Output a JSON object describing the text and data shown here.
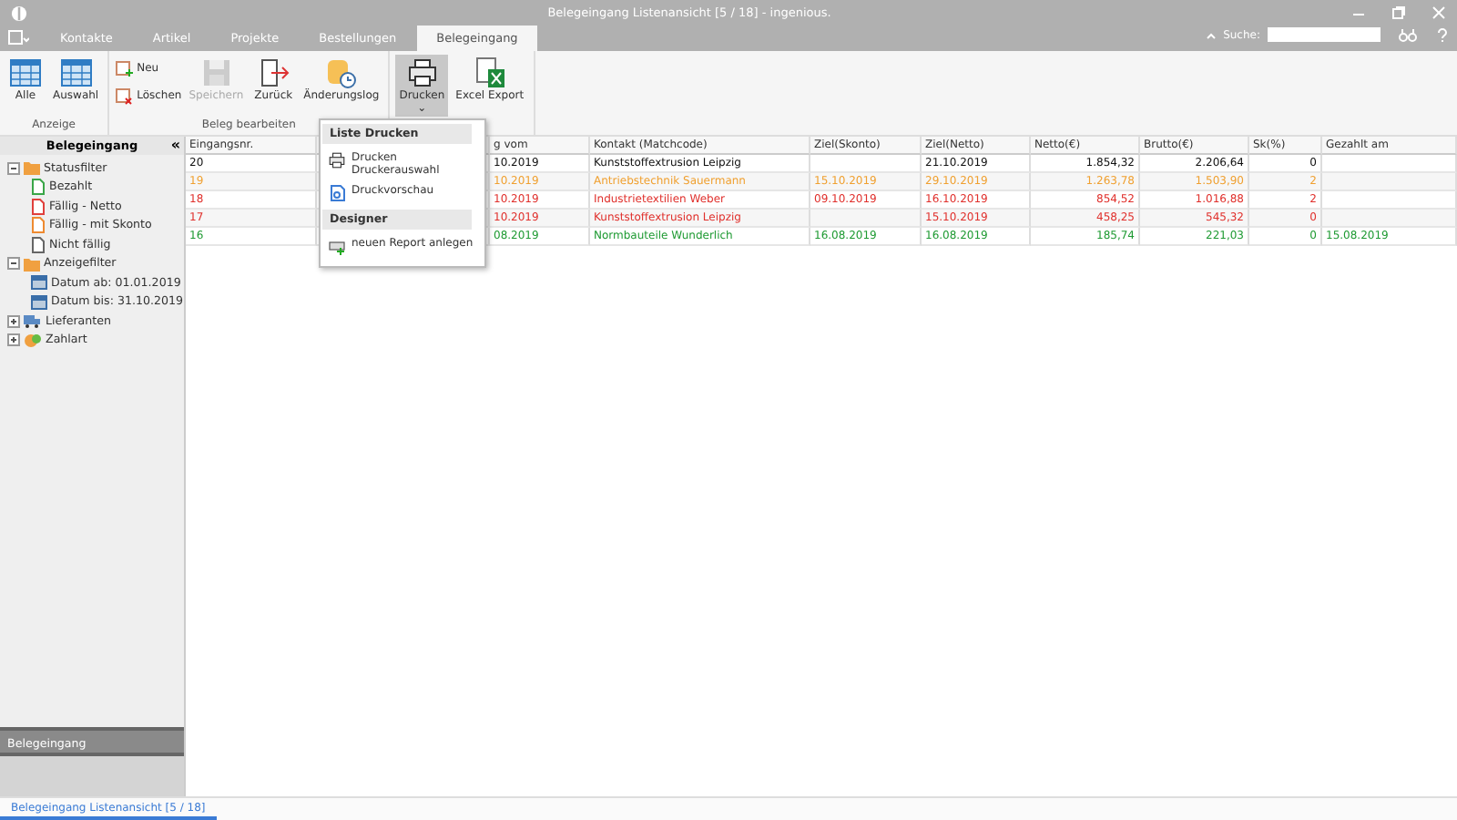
{
  "window": {
    "title": "Belegeingang Listenansicht [5 / 18] - ingenious."
  },
  "tabs": [
    {
      "label": "Kontakte",
      "selected": false
    },
    {
      "label": "Artikel",
      "selected": false
    },
    {
      "label": "Projekte",
      "selected": false
    },
    {
      "label": "Bestellungen",
      "selected": false
    },
    {
      "label": "Belegeingang",
      "selected": true
    }
  ],
  "search": {
    "label": "Suche:"
  },
  "ribbon": [
    {
      "title": "Anzeige",
      "buttons": [
        {
          "kind": "large",
          "label": "Alle",
          "disabled": false,
          "pressed": false
        },
        {
          "kind": "large",
          "label": "Auswahl",
          "disabled": false,
          "pressed": false
        }
      ]
    },
    {
      "title": "Beleg bearbeiten",
      "buttons": [
        {
          "kind": "small",
          "label": "Neu"
        },
        {
          "kind": "small",
          "label": "Löschen"
        },
        {
          "kind": "large",
          "label": "Speichern",
          "disabled": true,
          "pressed": false
        },
        {
          "kind": "large",
          "label": "Zurück",
          "disabled": false,
          "pressed": false
        },
        {
          "kind": "large",
          "label": "Änderungslog",
          "disabled": false,
          "pressed": false
        }
      ]
    },
    {
      "buttons": [
        {
          "kind": "large",
          "label": "Drucken",
          "disabled": false,
          "pressed": true,
          "caret": "⌄"
        },
        {
          "kind": "large",
          "label": "Excel Export",
          "disabled": false,
          "pressed": false
        }
      ]
    }
  ],
  "sidebar": {
    "title": "Belegeingang",
    "collapse": "«",
    "tree": [
      {
        "label": "Statusfilter",
        "expanded": true,
        "children": [
          {
            "kind": "status",
            "label": "Bezahlt",
            "color": "#3aa648"
          },
          {
            "kind": "status",
            "label": "Fällig - Netto",
            "color": "#e0403c"
          },
          {
            "kind": "status",
            "label": "Fällig - mit Skonto",
            "color": "#ee8a30"
          },
          {
            "kind": "status",
            "label": "Nicht fällig",
            "color": "#666666"
          }
        ]
      },
      {
        "label": "Anzeigefilter",
        "expanded": true,
        "children": [
          {
            "kind": "date",
            "label": "Datum ab: 01.01.2019"
          },
          {
            "kind": "date",
            "label": "Datum bis: 31.10.2019"
          }
        ]
      },
      {
        "label": "Lieferanten",
        "expanded": false
      },
      {
        "label": "Zahlart",
        "expanded": false
      }
    ],
    "bottom_panel": "Belegeingang"
  },
  "table": {
    "columns": [
      "Eingangsnr.",
      "",
      "g vom",
      "Kontakt (Matchcode)",
      "Ziel(Skonto)",
      "Ziel(Netto)",
      "Netto(€)",
      "Brutto(€)",
      "Sk(%)",
      "Gezahlt am"
    ],
    "rows": [
      {
        "color": "#111111",
        "cells": [
          "20",
          "",
          "10.2019",
          "Kunststoffextrusion Leipzig",
          "",
          "21.10.2019",
          "1.854,32",
          "2.206,64",
          "0",
          ""
        ]
      },
      {
        "color": "#f0a030",
        "cells": [
          "19",
          "",
          "10.2019",
          "Antriebstechnik Sauermann",
          "15.10.2019",
          "29.10.2019",
          "1.263,78",
          "1.503,90",
          "2",
          ""
        ]
      },
      {
        "color": "#e0302c",
        "cells": [
          "18",
          "",
          "10.2019",
          "Industrietextilien Weber",
          "09.10.2019",
          "16.10.2019",
          "854,52",
          "1.016,88",
          "2",
          ""
        ]
      },
      {
        "color": "#e0302c",
        "cells": [
          "17",
          "",
          "10.2019",
          "Kunststoffextrusion Leipzig",
          "",
          "15.10.2019",
          "458,25",
          "545,32",
          "0",
          ""
        ]
      },
      {
        "color": "#1e9a32",
        "cells": [
          "16",
          "",
          "08.2019",
          "Normbauteile Wunderlich",
          "16.08.2019",
          "16.08.2019",
          "185,74",
          "221,03",
          "0",
          "15.08.2019"
        ]
      }
    ]
  },
  "dropdown": {
    "sections": [
      {
        "title": "Liste Drucken",
        "items": [
          {
            "label": "Drucken",
            "sublabel": "Druckerauswahl"
          },
          {
            "label": "Druckvorschau"
          }
        ]
      },
      {
        "title": "Designer",
        "items": [
          {
            "label": "neuen Report anlegen"
          }
        ]
      }
    ]
  },
  "status_bar": {
    "tabs": [
      {
        "label": "Belegeingang Listenansicht [5 / 18]",
        "selected": true
      }
    ]
  }
}
